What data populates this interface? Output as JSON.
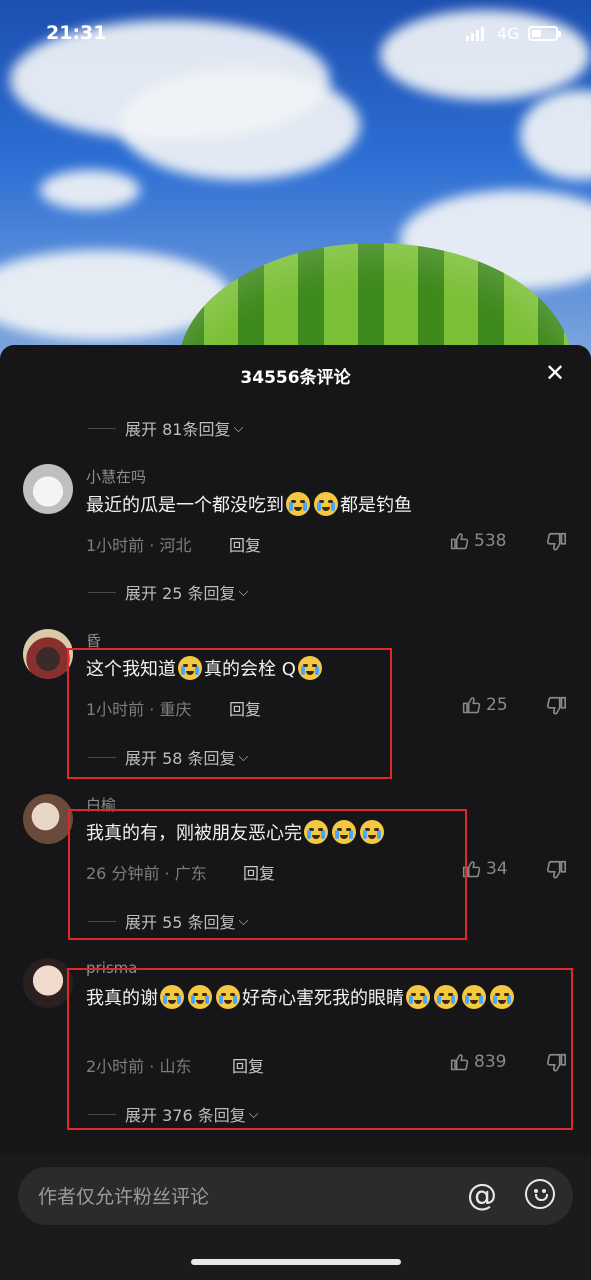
{
  "status": {
    "time": "21:31",
    "network": "4G"
  },
  "panel": {
    "title": "34556条评论"
  },
  "expand_top": "展开 81条回复",
  "comments": [
    {
      "user": "小慧在吗",
      "text_a": "最近的瓜是一个都没吃到",
      "text_b": "都是钓鱼",
      "time_loc": "1小时前 · 河北",
      "reply": "回复",
      "likes": "538",
      "expand": "展开 25 条回复"
    },
    {
      "user": "昏",
      "text_a": "这个我知道",
      "text_b": "真的会栓 Q",
      "time_loc": "1小时前 · 重庆",
      "reply": "回复",
      "likes": "25",
      "expand": "展开 58 条回复"
    },
    {
      "user": "白榆",
      "text_a": "我真的有，刚被朋友恶心完",
      "time_loc": "26 分钟前 · 广东",
      "reply": "回复",
      "likes": "34",
      "expand": "展开 55 条回复"
    },
    {
      "user": "prisma",
      "text_a": "我真的谢",
      "text_b": "好奇心害死我的眼睛",
      "time_loc": "2小时前 · 山东",
      "reply": "回复",
      "likes": "839",
      "expand": "展开 376 条回复"
    }
  ],
  "input": {
    "placeholder": "作者仅允许粉丝评论"
  },
  "colors": {
    "highlight": "#e0282a",
    "panel": "#161618"
  },
  "icons": [
    "close-icon",
    "chevron-down-icon",
    "thumb-up-icon",
    "thumb-down-icon",
    "at-icon",
    "emoji-icon",
    "battery-icon",
    "signal-icon"
  ]
}
